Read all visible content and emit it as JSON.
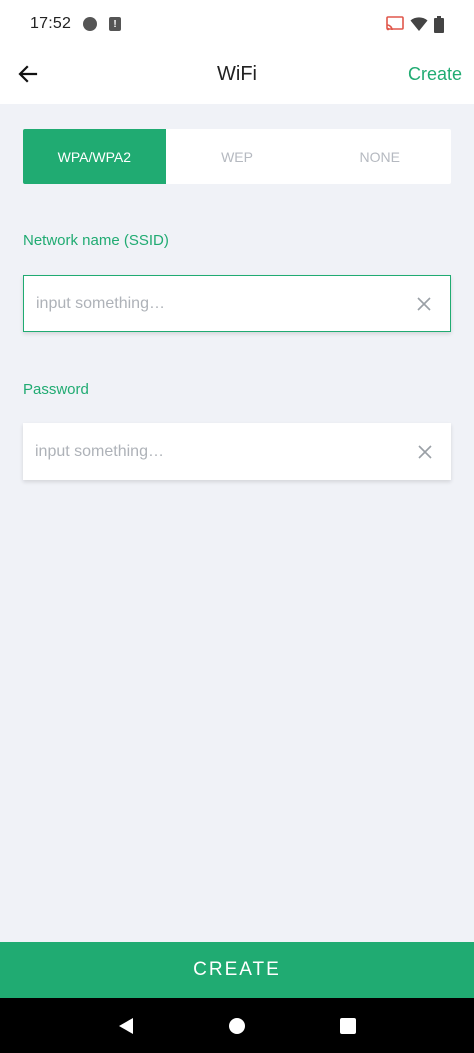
{
  "status_bar": {
    "time": "17:52",
    "alert_glyph": "!"
  },
  "app_bar": {
    "title": "WiFi",
    "action_label": "Create"
  },
  "security_tabs": [
    {
      "label": "WPA/WPA2",
      "active": true
    },
    {
      "label": "WEP",
      "active": false
    },
    {
      "label": "NONE",
      "active": false
    }
  ],
  "ssid_field": {
    "label": "Network name (SSID)",
    "value": "",
    "placeholder": "input something…"
  },
  "password_field": {
    "label": "Password",
    "value": "",
    "placeholder": "input something…"
  },
  "create_button": {
    "label": "CREATE"
  },
  "colors": {
    "accent": "#20ab72",
    "background": "#f0f2f7"
  },
  "icons": {
    "back": "arrow-left-icon",
    "clear": "close-icon",
    "cast": "cast-icon",
    "wifi": "wifi-icon",
    "battery": "battery-icon",
    "nav_back": "triangle-back-icon",
    "nav_home": "circle-home-icon",
    "nav_recents": "square-recents-icon"
  }
}
